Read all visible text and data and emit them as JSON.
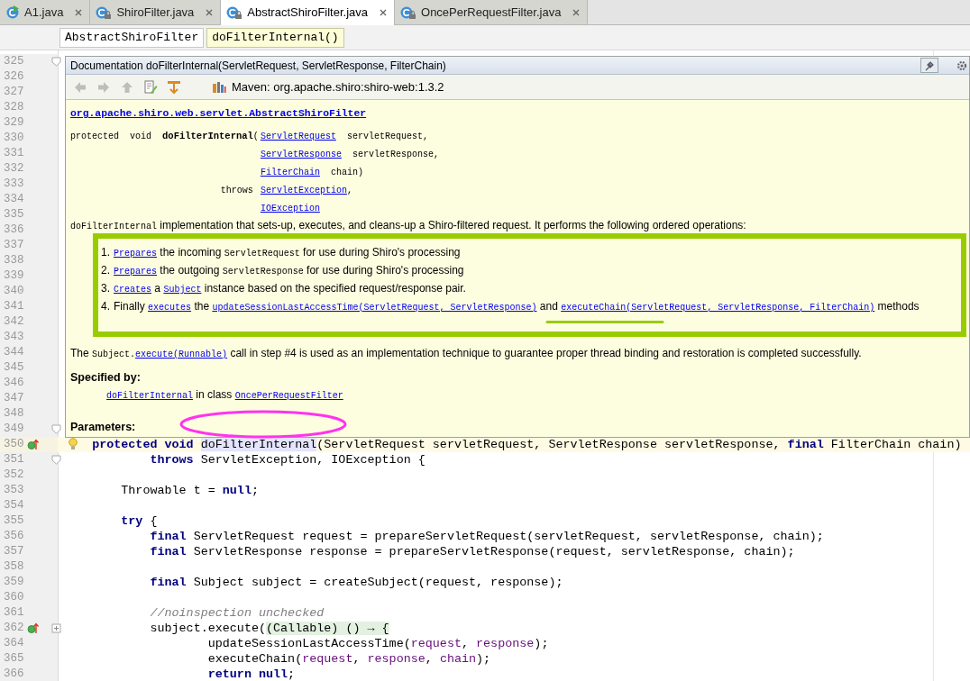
{
  "tabs": [
    {
      "label": "A1.java",
      "kind": "runnable_class",
      "selected": false
    },
    {
      "label": "ShiroFilter.java",
      "kind": "locked_class",
      "selected": false
    },
    {
      "label": "AbstractShiroFilter.java",
      "kind": "locked_class",
      "selected": true
    },
    {
      "label": "OncePerRequestFilter.java",
      "kind": "locked_class",
      "selected": false
    }
  ],
  "breadcrumbs": [
    {
      "label": "AbstractShiroFilter",
      "selected": false
    },
    {
      "label": "doFilterInternal()",
      "selected": true
    }
  ],
  "editor": {
    "lines": [
      {
        "number": "325",
        "current": false,
        "icons": [
          {
            "kind": "fold_marker"
          }
        ]
      },
      {
        "number": "326",
        "current": false
      },
      {
        "number": "327",
        "current": false
      },
      {
        "number": "328",
        "current": false
      },
      {
        "number": "329",
        "current": false
      },
      {
        "number": "330",
        "current": false
      },
      {
        "number": "331",
        "current": false
      },
      {
        "number": "332",
        "current": false
      },
      {
        "number": "333",
        "current": false
      },
      {
        "number": "334",
        "current": false
      },
      {
        "number": "335",
        "current": false
      },
      {
        "number": "336",
        "current": false
      },
      {
        "number": "337",
        "current": false
      },
      {
        "number": "338",
        "current": false
      },
      {
        "number": "339",
        "current": false
      },
      {
        "number": "340",
        "current": false
      },
      {
        "number": "341",
        "current": false
      },
      {
        "number": "342",
        "current": false
      },
      {
        "number": "343",
        "current": false
      },
      {
        "number": "344",
        "current": false
      },
      {
        "number": "345",
        "current": false
      },
      {
        "number": "346",
        "current": false
      },
      {
        "number": "347",
        "current": false
      },
      {
        "number": "348",
        "current": false
      },
      {
        "number": "349",
        "current": false,
        "icons": [
          {
            "kind": "fold_marker"
          }
        ]
      },
      {
        "number": "350",
        "current": true,
        "icons": [
          {
            "kind": "implements"
          },
          {
            "kind": "bulb"
          }
        ],
        "code": [
          {
            "kind": "kw",
            "text": "    protected void "
          },
          {
            "kind": "highlight",
            "text": "doFilterInternal"
          },
          {
            "kind": "plain",
            "text": "(ServletRequest servletRequest, ServletResponse servletResponse, "
          },
          {
            "kind": "kw",
            "text": "final"
          },
          {
            "kind": "plain",
            "text": " FilterChain chain)"
          }
        ]
      },
      {
        "number": "351",
        "current": false,
        "icons": [
          {
            "kind": "fold_marker"
          }
        ],
        "code": [
          {
            "kind": "kw",
            "text": "            throws"
          },
          {
            "kind": "plain",
            "text": " ServletException, IOException {"
          }
        ]
      },
      {
        "number": "352",
        "current": false
      },
      {
        "number": "353",
        "current": false,
        "code": [
          {
            "kind": "plain",
            "text": "        Throwable t = "
          },
          {
            "kind": "kw",
            "text": "null"
          },
          {
            "kind": "plain",
            "text": ";"
          }
        ]
      },
      {
        "number": "354",
        "current": false
      },
      {
        "number": "355",
        "current": false,
        "code": [
          {
            "kind": "kw",
            "text": "        try"
          },
          {
            "kind": "plain",
            "text": " {"
          }
        ]
      },
      {
        "number": "356",
        "current": false,
        "code": [
          {
            "kind": "kw",
            "text": "            final"
          },
          {
            "kind": "plain",
            "text": " ServletRequest request = prepareServletRequest(servletRequest, servletResponse, chain);"
          }
        ]
      },
      {
        "number": "357",
        "current": false,
        "code": [
          {
            "kind": "kw",
            "text": "            final"
          },
          {
            "kind": "plain",
            "text": " ServletResponse response = prepareServletResponse(request, servletResponse, chain);"
          }
        ]
      },
      {
        "number": "358",
        "current": false
      },
      {
        "number": "359",
        "current": false,
        "code": [
          {
            "kind": "kw",
            "text": "            final"
          },
          {
            "kind": "plain",
            "text": " Subject subject = createSubject(request, response);"
          }
        ]
      },
      {
        "number": "360",
        "current": false
      },
      {
        "number": "361",
        "current": false,
        "code": [
          {
            "kind": "comment",
            "text": "            //noinspection unchecked"
          }
        ]
      },
      {
        "number": "362",
        "current": false,
        "icons": [
          {
            "kind": "implements"
          },
          {
            "kind": "fold_collapsed"
          }
        ],
        "code": [
          {
            "kind": "plain",
            "text": "            subject.execute("
          },
          {
            "kind": "fold",
            "text": "(Callable) () → {"
          }
        ]
      },
      {
        "number": "364",
        "current": false,
        "code": [
          {
            "kind": "plain",
            "text": "                    updateSessionLastAccessTime("
          },
          {
            "kind": "param",
            "text": "request"
          },
          {
            "kind": "plain",
            "text": ", "
          },
          {
            "kind": "param",
            "text": "response"
          },
          {
            "kind": "plain",
            "text": ");"
          }
        ]
      },
      {
        "number": "365",
        "current": false,
        "code": [
          {
            "kind": "plain",
            "text": "                    executeChain("
          },
          {
            "kind": "param",
            "text": "request"
          },
          {
            "kind": "plain",
            "text": ", "
          },
          {
            "kind": "param",
            "text": "response"
          },
          {
            "kind": "plain",
            "text": ", "
          },
          {
            "kind": "param",
            "text": "chain"
          },
          {
            "kind": "plain",
            "text": ");"
          }
        ]
      },
      {
        "number": "366",
        "current": false,
        "code": [
          {
            "kind": "kw",
            "text": "                    return null"
          },
          {
            "kind": "plain",
            "text": ";"
          }
        ]
      }
    ]
  },
  "doc_popup": {
    "title": "Documentation doFilterInternal(ServletRequest, ServletResponse, FilterChain)",
    "toolbar": [
      {
        "kind": "back",
        "disabled": true
      },
      {
        "kind": "forward",
        "disabled": true
      },
      {
        "kind": "up",
        "disabled": true
      },
      {
        "kind": "edit",
        "disabled": false
      },
      {
        "kind": "external",
        "disabled": false
      }
    ],
    "library": "Maven: org.apache.shiro:shiro-web:1.3.2",
    "class_link": "org.apache.shiro.web.servlet.AbstractShiroFilter",
    "signature": [
      {
        "lead": [
          {
            "kind": "code",
            "text": "protected  void  "
          },
          {
            "kind": "bold",
            "text": "doFilterInternal"
          },
          {
            "kind": "code",
            "text": "("
          }
        ],
        "rest": [
          {
            "kind": "link",
            "text": "ServletRequest"
          },
          {
            "kind": "code",
            "text": "  servletRequest,"
          }
        ]
      },
      {
        "rest": [
          {
            "kind": "link",
            "text": "ServletResponse"
          },
          {
            "kind": "code",
            "text": "  servletResponse,"
          }
        ]
      },
      {
        "rest": [
          {
            "kind": "link",
            "text": "FilterChain"
          },
          {
            "kind": "code",
            "text": "  chain)"
          }
        ]
      },
      {
        "lead": [
          {
            "kind": "code",
            "text": "throws "
          }
        ],
        "rest": [
          {
            "kind": "link",
            "text": "ServletException"
          },
          {
            "kind": "code",
            "text": ","
          }
        ]
      },
      {
        "rest": [
          {
            "kind": "link",
            "text": "IOException"
          }
        ]
      }
    ],
    "description": [
      {
        "kind": "code",
        "text": "doFilterInternal"
      },
      {
        "kind": "text",
        "text": " implementation that sets-up, executes, and cleans-up a Shiro-filtered request. It performs the following ordered operations:"
      }
    ],
    "steps": [
      {
        "number": "1.",
        "segments": [
          {
            "kind": "link",
            "text": "Prepares"
          },
          {
            "kind": "text",
            "text": " the incoming "
          },
          {
            "kind": "code",
            "text": "ServletRequest"
          },
          {
            "kind": "text",
            "text": " for use during Shiro's processing"
          }
        ]
      },
      {
        "number": "2.",
        "segments": [
          {
            "kind": "link",
            "text": "Prepares"
          },
          {
            "kind": "text",
            "text": " the outgoing "
          },
          {
            "kind": "code",
            "text": "ServletResponse"
          },
          {
            "kind": "text",
            "text": " for use during Shiro's processing"
          }
        ]
      },
      {
        "number": "3.",
        "segments": [
          {
            "kind": "link",
            "text": "Creates"
          },
          {
            "kind": "text",
            "text": " a "
          },
          {
            "kind": "link",
            "text": "Subject"
          },
          {
            "kind": "text",
            "text": " instance based on the specified request/response pair."
          }
        ]
      },
      {
        "number": "4.",
        "segments": [
          {
            "kind": "text",
            "text": "Finally "
          },
          {
            "kind": "link",
            "text": "executes"
          },
          {
            "kind": "text",
            "text": " the "
          },
          {
            "kind": "link",
            "text": "updateSessionLastAccessTime(ServletRequest, ServletResponse)"
          },
          {
            "kind": "text",
            "text": " and "
          },
          {
            "kind": "link",
            "text": "executeChain(ServletRequest, ServletResponse, FilterChain)"
          },
          {
            "kind": "text",
            "text": " methods"
          }
        ]
      }
    ],
    "note": [
      {
        "kind": "text",
        "text": "The "
      },
      {
        "kind": "code",
        "text": "Subject."
      },
      {
        "kind": "link",
        "text": "execute(Runnable)"
      },
      {
        "kind": "text",
        "text": " call in step #4 is used as an implementation technique to guarantee proper thread binding and restoration is completed successfully."
      }
    ],
    "specified_by": {
      "heading": "Specified by:",
      "segments": [
        {
          "kind": "link",
          "text": "doFilterInternal"
        },
        {
          "kind": "text",
          "text": " in class "
        },
        {
          "kind": "link",
          "text": "OncePerRequestFilter"
        }
      ]
    },
    "parameters_heading": "Parameters:"
  }
}
